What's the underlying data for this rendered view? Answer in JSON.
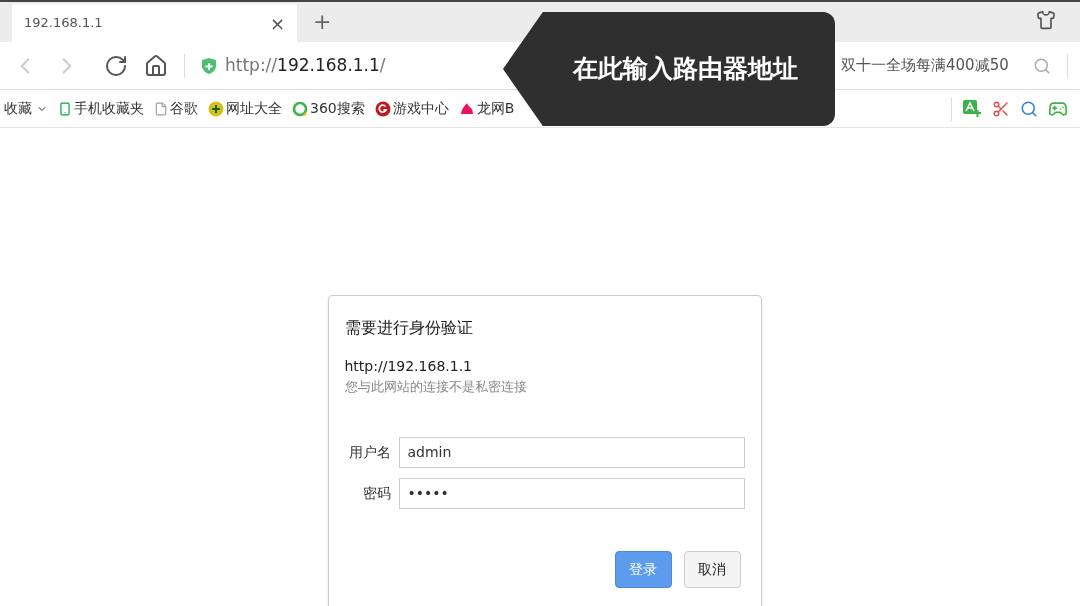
{
  "tabs": [
    {
      "title": "192.168.1.1",
      "close": "×",
      "selected": true
    }
  ],
  "new_tab": "+",
  "address_bar": {
    "scheme": "http://",
    "host": "192.168.1.1",
    "path": "/"
  },
  "promo_search": {
    "placeholder": "双十一全场每满400减50"
  },
  "bookmarks": [
    {
      "label": "收藏",
      "kind": "menu"
    },
    {
      "label": "手机收藏夹",
      "kind": "phone"
    },
    {
      "label": "谷歌",
      "kind": "page"
    },
    {
      "label": "网址大全",
      "kind": "plus"
    },
    {
      "label": "360搜索",
      "kind": "ring"
    },
    {
      "label": "游戏中心",
      "kind": "game"
    },
    {
      "label": "龙网B",
      "kind": "dragon"
    }
  ],
  "callout": {
    "text": "在此输入路由器地址"
  },
  "auth_dialog": {
    "title": "需要进行身份验证",
    "url": "http://192.168.1.1",
    "notice": "您与此网站的连接不是私密连接",
    "fields": [
      {
        "label": "用户名",
        "value": "admin"
      },
      {
        "label": "密码",
        "value": "•••••"
      }
    ],
    "buttons": [
      {
        "label": "登录",
        "primary": true
      },
      {
        "label": "取消",
        "primary": false
      }
    ]
  }
}
